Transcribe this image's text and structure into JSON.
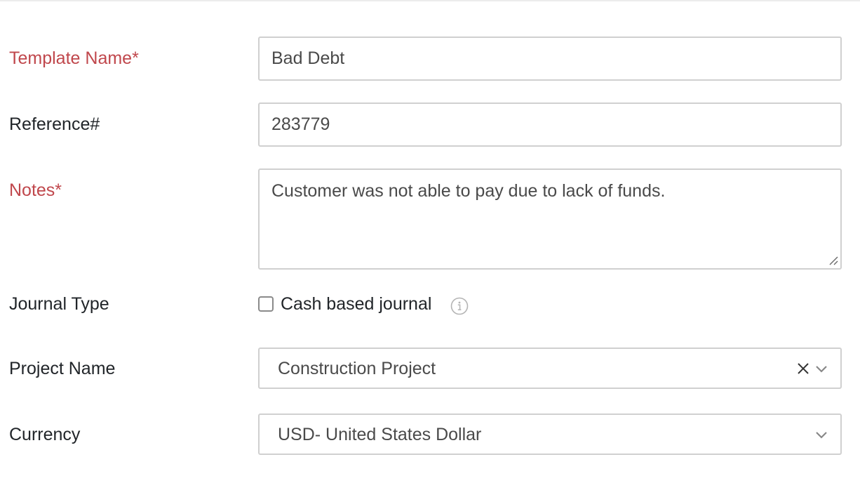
{
  "form": {
    "template_name": {
      "label": "Template Name*",
      "value": "Bad Debt"
    },
    "reference": {
      "label": "Reference#",
      "value": "283779"
    },
    "notes": {
      "label": "Notes*",
      "value": "Customer was not able to pay due to lack of funds."
    },
    "journal_type": {
      "label": "Journal Type",
      "checkbox_label": "Cash based journal",
      "checked": false,
      "info_icon": "info-icon"
    },
    "project_name": {
      "label": "Project Name",
      "value": "Construction Project",
      "clear_icon": "close-icon",
      "dropdown_icon": "chevron-down-icon"
    },
    "currency": {
      "label": "Currency",
      "value": "USD- United States Dollar",
      "dropdown_icon": "chevron-down-icon"
    }
  },
  "colors": {
    "required_label": "#c0474c",
    "border": "#d0d0d0",
    "text": "#212529",
    "input_text": "#4a4a4a"
  }
}
